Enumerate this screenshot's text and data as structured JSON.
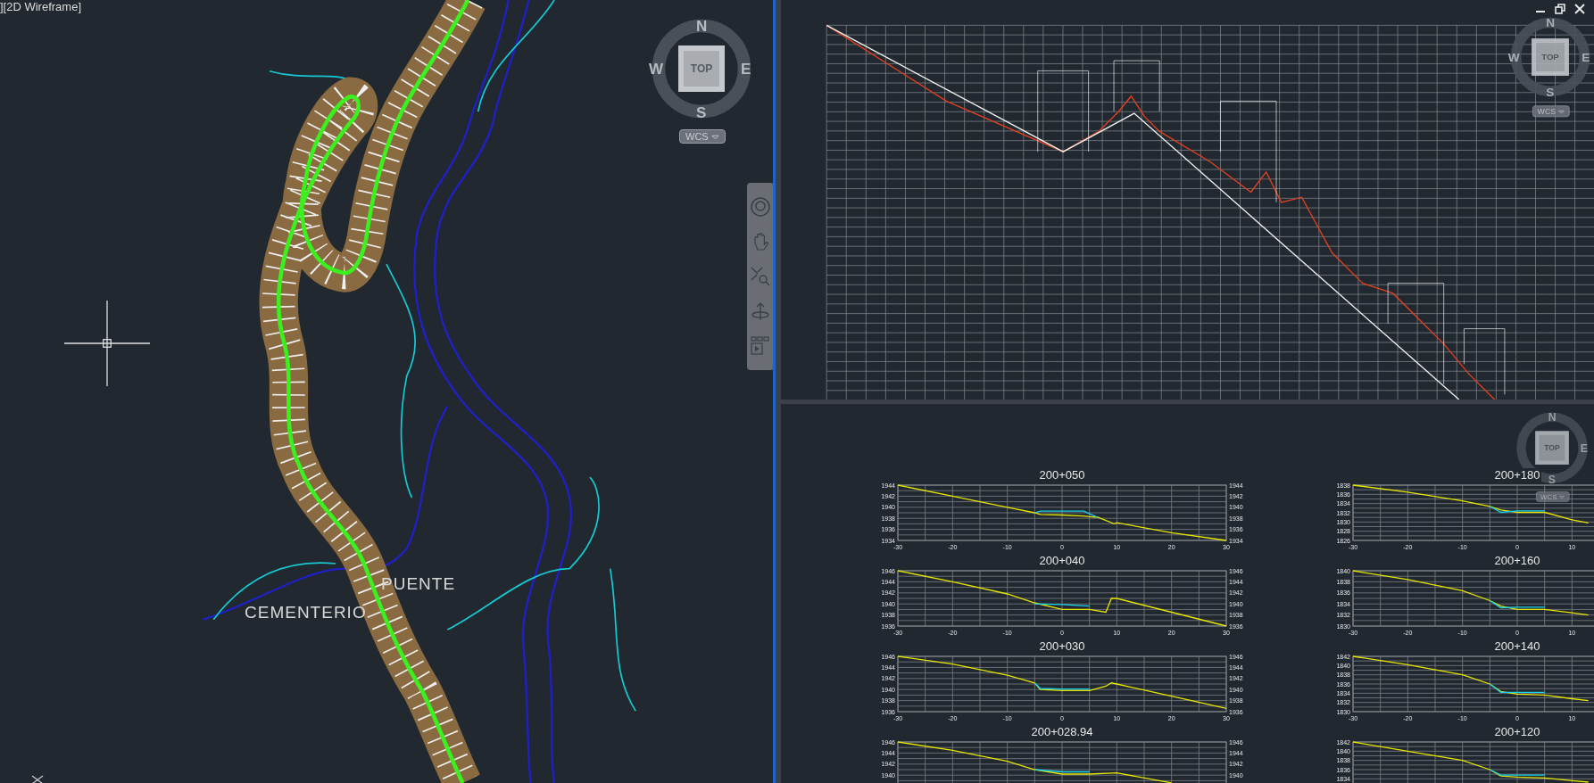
{
  "model_view": {
    "label": "][2D Wireframe]",
    "map_labels": [
      "PUENTE",
      "CEMENTERIO"
    ],
    "viewcube": {
      "north": "N",
      "west": "W",
      "east": "E",
      "south": "S",
      "top": "TOP",
      "ucs": "WCS"
    }
  },
  "profile_view": {
    "viewcube": {
      "north": "N",
      "west": "W",
      "east": "E",
      "south": "S",
      "top": "TOP",
      "ucs": "WCS"
    }
  },
  "section_view": {
    "viewcube": {
      "north": "N",
      "east": "E",
      "south": "S",
      "top": "TOP",
      "ucs": "WCS"
    },
    "sections": [
      {
        "right_labels": [
          "1944",
          "1942",
          "1940",
          "1938",
          "1936",
          "1934"
        ],
        "chart_data": {
          "type": "line",
          "title": "200+050",
          "x": [
            -30,
            -20,
            -10,
            -5,
            -4,
            0,
            4,
            5,
            6.5,
            9.5,
            10,
            20,
            30
          ],
          "xlim": [
            -30,
            30
          ],
          "ylim": [
            1934,
            1944
          ],
          "grid": true,
          "xticks": [
            -30,
            -20,
            -10,
            0,
            10,
            20,
            30
          ],
          "yticks": [
            1934,
            1936,
            1938,
            1940,
            1942,
            1944
          ],
          "series": [
            {
              "color": "#e6e600",
              "values": [
                1944,
                1942,
                1940,
                1939,
                1938.7,
                1938.6,
                1938.4,
                1938.3,
                1938.2,
                1937,
                1937.2,
                1935.4,
                1934
              ]
            },
            {
              "color": "#19d2ee",
              "values": [
                null,
                null,
                null,
                1939,
                1939.3,
                1939.3,
                1939.3,
                1938.8,
                1938.2,
                null,
                null,
                null,
                null
              ]
            }
          ]
        }
      },
      {
        "chart_data": {
          "type": "line",
          "title": "200+180",
          "x": [
            -30,
            -20,
            -10,
            -5,
            -3,
            0,
            5,
            10,
            13
          ],
          "xlim": [
            -30,
            30
          ],
          "ylim": [
            1826,
            1838
          ],
          "grid": true,
          "xticks": [
            -30,
            -20,
            -10,
            0,
            10
          ],
          "yticks": [
            1826,
            1828,
            1830,
            1832,
            1834,
            1836,
            1838
          ],
          "series": [
            {
              "color": "#e6e600",
              "values": [
                1838,
                1836.5,
                1834.6,
                1833.4,
                1832.6,
                1832.1,
                1832.1,
                1830.5,
                1829.8
              ]
            },
            {
              "color": "#19d2ee",
              "values": [
                null,
                null,
                null,
                1833.4,
                1832.1,
                1832.4,
                1832.4,
                null,
                null
              ]
            }
          ]
        }
      },
      {
        "right_labels": [
          "1946",
          "1944",
          "1942",
          "1940",
          "1938",
          "1936"
        ],
        "chart_data": {
          "type": "line",
          "title": "200+040",
          "x": [
            -30,
            -20,
            -10,
            -5,
            0,
            5,
            8,
            9,
            10,
            20,
            30
          ],
          "xlim": [
            -30,
            30
          ],
          "ylim": [
            1936,
            1946
          ],
          "grid": true,
          "xticks": [
            -30,
            -20,
            -10,
            0,
            10,
            20,
            30
          ],
          "yticks": [
            1936,
            1938,
            1940,
            1942,
            1944,
            1946
          ],
          "series": [
            {
              "color": "#e6e600",
              "values": [
                1946,
                1944,
                1941.8,
                1940.2,
                1939,
                1939,
                1938.5,
                1941,
                1941,
                1938.5,
                1936
              ]
            },
            {
              "color": "#19d2ee",
              "values": [
                null,
                null,
                null,
                1940,
                1939.9,
                1939.6,
                null,
                null,
                null,
                null,
                null
              ]
            }
          ]
        }
      },
      {
        "chart_data": {
          "type": "line",
          "title": "200+160",
          "x": [
            -30,
            -20,
            -10,
            -5,
            -3,
            0,
            5,
            10,
            13
          ],
          "xlim": [
            -30,
            30
          ],
          "ylim": [
            1830,
            1840
          ],
          "grid": true,
          "xticks": [
            -30,
            -20,
            -10,
            0,
            10
          ],
          "yticks": [
            1830,
            1832,
            1834,
            1836,
            1838,
            1840
          ],
          "series": [
            {
              "color": "#e6e600",
              "values": [
                1840,
                1838.4,
                1836.4,
                1834.6,
                1833.6,
                1833,
                1833,
                1832.4,
                1832
              ]
            },
            {
              "color": "#19d2ee",
              "values": [
                null,
                null,
                null,
                1834.6,
                1833.3,
                1833.4,
                1833.4,
                null,
                null
              ]
            }
          ]
        }
      },
      {
        "right_labels": [
          "1946",
          "1944",
          "1942",
          "1940",
          "1938",
          "1936"
        ],
        "chart_data": {
          "type": "line",
          "title": "200+030",
          "x": [
            -30,
            -20,
            -10,
            -5,
            -4,
            0,
            5,
            8,
            9,
            10,
            20,
            30
          ],
          "xlim": [
            -30,
            30
          ],
          "ylim": [
            1936,
            1946
          ],
          "grid": true,
          "xticks": [
            -30,
            -20,
            -10,
            0,
            10,
            20,
            30
          ],
          "yticks": [
            1936,
            1938,
            1940,
            1942,
            1944,
            1946
          ],
          "series": [
            {
              "color": "#e6e600",
              "values": [
                1946,
                1944.6,
                1942.6,
                1941.2,
                1940,
                1939.8,
                1939.8,
                1940.6,
                1941.2,
                1941,
                1938.8,
                1936.6
              ]
            },
            {
              "color": "#19d2ee",
              "values": [
                null,
                null,
                null,
                1941.2,
                1940.2,
                1940.1,
                1940.1,
                null,
                null,
                null,
                null,
                null
              ]
            }
          ]
        }
      },
      {
        "chart_data": {
          "type": "line",
          "title": "200+140",
          "x": [
            -30,
            -20,
            -10,
            -5,
            -3,
            0,
            5,
            10,
            13
          ],
          "xlim": [
            -30,
            30
          ],
          "ylim": [
            1830,
            1842
          ],
          "grid": true,
          "xticks": [
            -30,
            -20,
            -10,
            0,
            10
          ],
          "yticks": [
            1830,
            1832,
            1834,
            1836,
            1838,
            1840,
            1842
          ],
          "series": [
            {
              "color": "#e6e600",
              "values": [
                1842,
                1840.2,
                1838,
                1836,
                1834.4,
                1833.8,
                1833.6,
                1832.8,
                1832.4
              ]
            },
            {
              "color": "#19d2ee",
              "values": [
                null,
                null,
                null,
                1836,
                1834.2,
                1834.2,
                1834.2,
                null,
                null
              ]
            }
          ]
        }
      },
      {
        "right_labels": [
          "1946",
          "1944",
          "1942",
          "1940"
        ],
        "chart_data": {
          "type": "line",
          "title": "200+028.94",
          "x": [
            -30,
            -20,
            -10,
            -5,
            0,
            5,
            10,
            20
          ],
          "xlim": [
            -30,
            30
          ],
          "ylim": [
            1936,
            1946
          ],
          "grid": true,
          "yticks": [
            1940,
            1942,
            1944,
            1946
          ],
          "series": [
            {
              "color": "#e6e600",
              "values": [
                1946,
                1944.5,
                1942.5,
                1941,
                1940.2,
                1940.2,
                1940.4,
                1938.6
              ]
            },
            {
              "color": "#19d2ee",
              "values": [
                null,
                null,
                null,
                1941,
                1940.6,
                1940.6,
                null,
                null
              ]
            }
          ]
        }
      },
      {
        "chart_data": {
          "type": "line",
          "title": "200+120",
          "x": [
            -30,
            -20,
            -10,
            -5,
            -3,
            0,
            5,
            10,
            13
          ],
          "xlim": [
            -30,
            30
          ],
          "ylim": [
            1830,
            1842
          ],
          "grid": true,
          "yticks": [
            1834,
            1836,
            1838,
            1840,
            1842
          ],
          "series": [
            {
              "color": "#e6e600",
              "values": [
                1842,
                1840,
                1838,
                1836,
                1834.6,
                1834.4,
                1834.2,
                1833.6,
                1833.3
              ]
            },
            {
              "color": "#19d2ee",
              "values": [
                null,
                null,
                null,
                1836,
                1834.8,
                1834.8,
                1834.8,
                null,
                null
              ]
            }
          ]
        }
      }
    ]
  }
}
